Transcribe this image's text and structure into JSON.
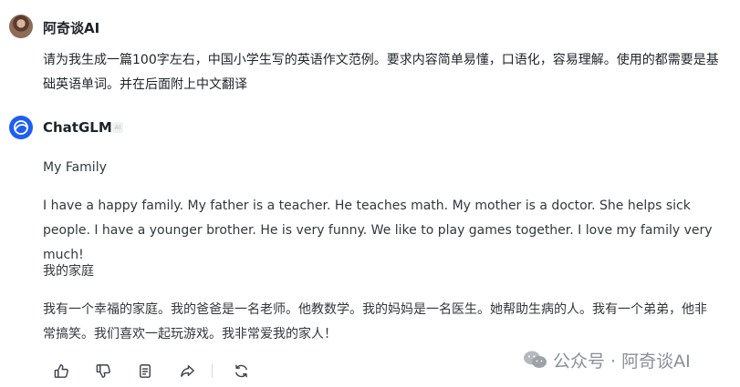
{
  "user_message": {
    "name": "阿奇谈AI",
    "text": "请为我生成一篇100字左右，中国小学生写的英语作文范例。要求内容简单易懂，口语化，容易理解。使用的都需要是基础英语单词。并在后面附上中文翻译"
  },
  "bot_message": {
    "name": "ChatGLM",
    "badge": "AI",
    "paragraphs": {
      "title_en": "My Family",
      "body_en": "I have a happy family. My father is a teacher. He teaches math. My mother is a doctor. She helps sick people. I have a younger brother. He is very funny. We like to play games together. I love my family very much!",
      "title_cn": "我的家庭",
      "body_cn": "我有一个幸福的家庭。我的爸爸是一名老师。他教数学。我的妈妈是一名医生。她帮助生病的人。我有一个弟弟，他非常搞笑。我们喜欢一起玩游戏。我非常爱我的家人！"
    }
  },
  "toolbar": {
    "icons": [
      "thumbs-up-icon",
      "thumbs-down-icon",
      "copy-icon",
      "share-icon",
      "regenerate-icon"
    ]
  },
  "watermark": {
    "text": "公众号 · 阿奇谈AI"
  }
}
